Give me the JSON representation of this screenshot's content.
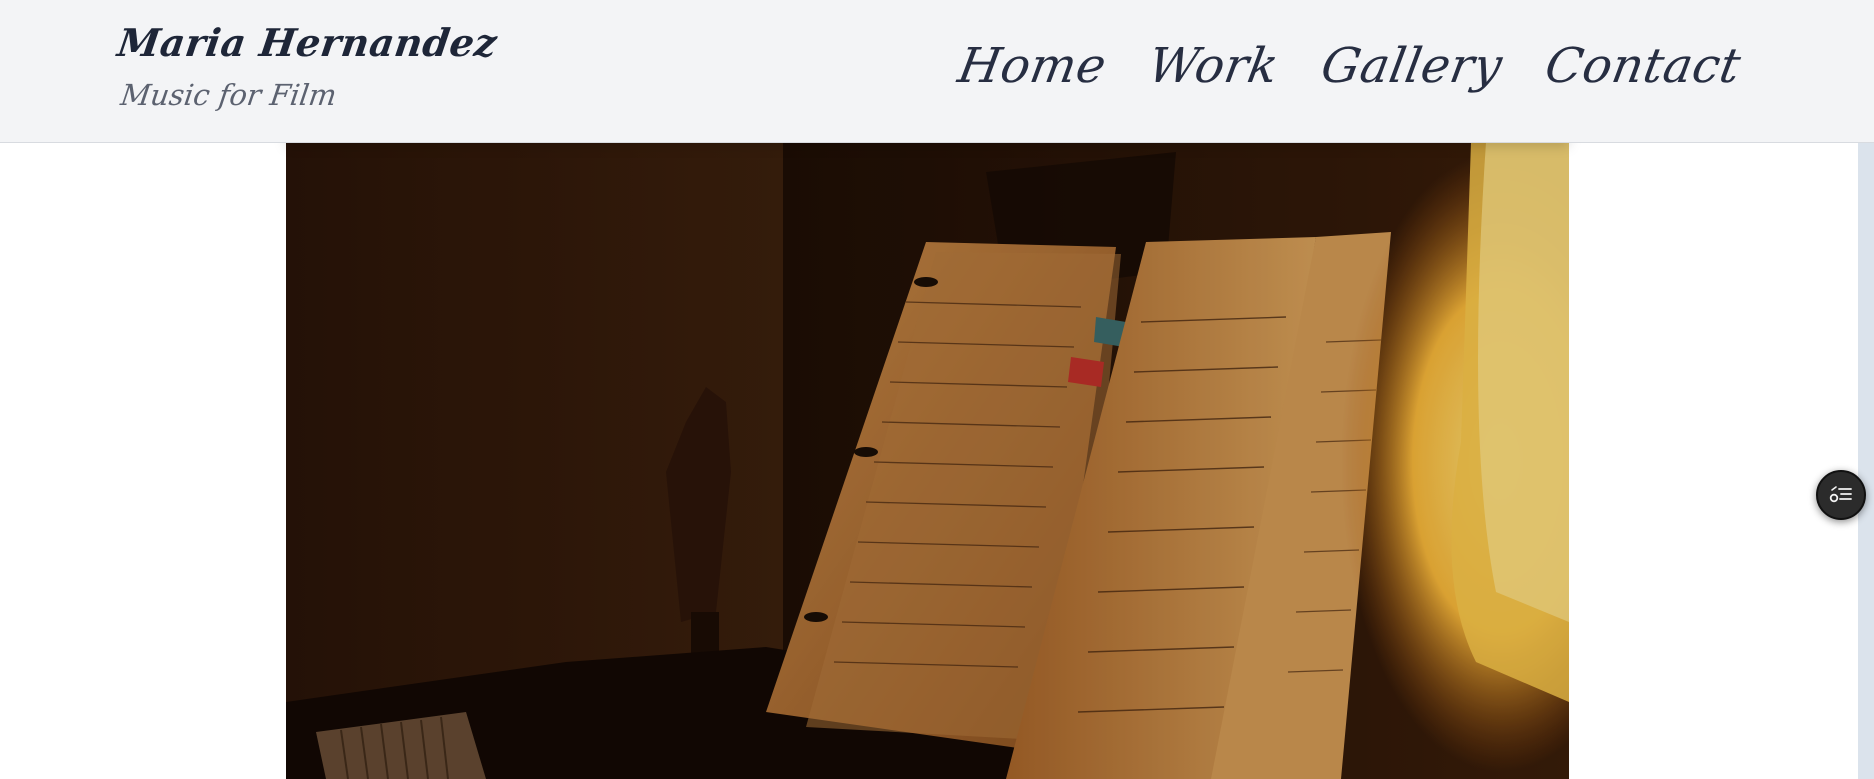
{
  "header": {
    "title": "Maria Hernandez",
    "subtitle": "Music for Film"
  },
  "nav": {
    "items": [
      {
        "label": "Home"
      },
      {
        "label": "Work"
      },
      {
        "label": "Gallery"
      },
      {
        "label": "Contact"
      }
    ]
  },
  "hero": {
    "image": "sheet-music-on-piano-photo"
  },
  "fab": {
    "icon": "accessibility-menu-icon"
  },
  "colors": {
    "header_bg": "#f3f4f6",
    "text_dark": "#1e2638",
    "text_muted": "#5c6270",
    "fab_bg": "#2b2b2b"
  }
}
